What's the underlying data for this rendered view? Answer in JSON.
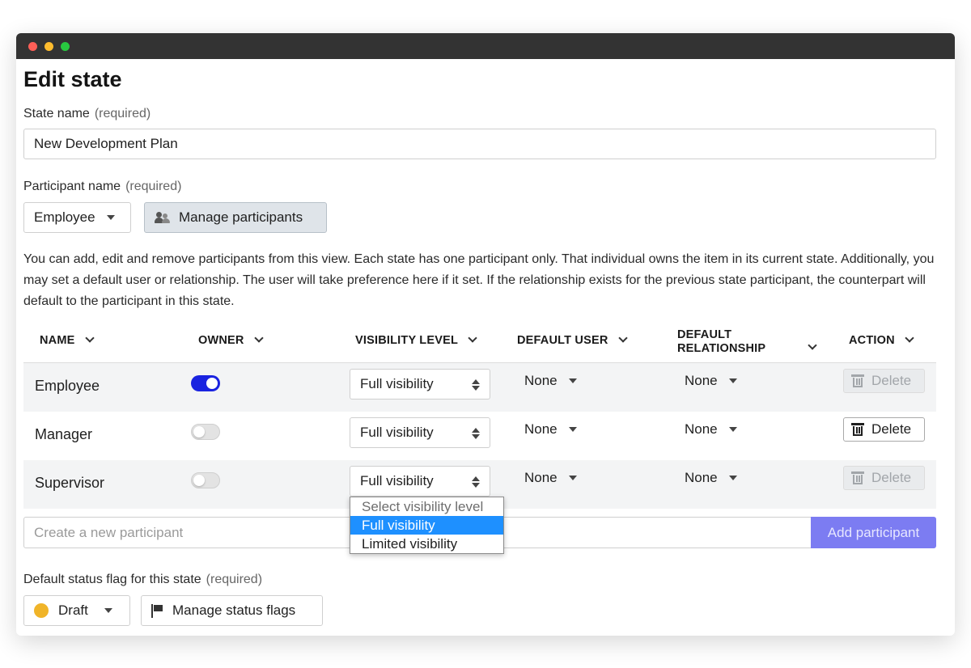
{
  "page": {
    "title": "Edit state"
  },
  "state_name": {
    "label": "State name",
    "required": "(required)",
    "value": "New Development Plan"
  },
  "participant": {
    "label": "Participant name",
    "required": "(required)",
    "selected": "Employee",
    "manage_label": "Manage participants"
  },
  "description": "You can add, edit and remove participants from this view. Each state has one participant only. That individual owns the item in its current state. Additionally, you may set a default user or relationship. The user will take preference here if it set. If the relationship exists for the previous state participant, the counterpart will default to the participant in this state.",
  "table": {
    "headers": {
      "name": "NAME",
      "owner": "OWNER",
      "visibility": "VISIBILITY LEVEL",
      "default_user": "DEFAULT USER",
      "default_relationship_1": "DEFAULT",
      "default_relationship_2": "RELATIONSHIP",
      "action": "ACTION"
    },
    "rows": [
      {
        "name": "Employee",
        "owner": true,
        "visibility": "Full visibility",
        "default_user": "None",
        "default_relationship": "None",
        "action": "Delete",
        "action_enabled": false
      },
      {
        "name": "Manager",
        "owner": false,
        "visibility": "Full visibility",
        "default_user": "None",
        "default_relationship": "None",
        "action": "Delete",
        "action_enabled": true
      },
      {
        "name": "Supervisor",
        "owner": false,
        "visibility": "Full visibility",
        "default_user": "None",
        "default_relationship": "None",
        "action": "Delete",
        "action_enabled": false
      }
    ]
  },
  "visibility_dropdown": {
    "options": [
      "Select visibility level",
      "Full visibility",
      "Limited visibility"
    ],
    "selected": "Full visibility"
  },
  "new_participant": {
    "placeholder": "Create a new participant",
    "add_label": "Add participant"
  },
  "status_flag": {
    "label": "Default status flag for this state",
    "required": "(required)",
    "selected": "Draft",
    "dot_color": "#f0b429",
    "manage_label": "Manage status flags"
  },
  "colors": {
    "toggle_on": "#1a23e0",
    "add_button": "#7c7cf2",
    "dropdown_highlight": "#1e90ff"
  }
}
